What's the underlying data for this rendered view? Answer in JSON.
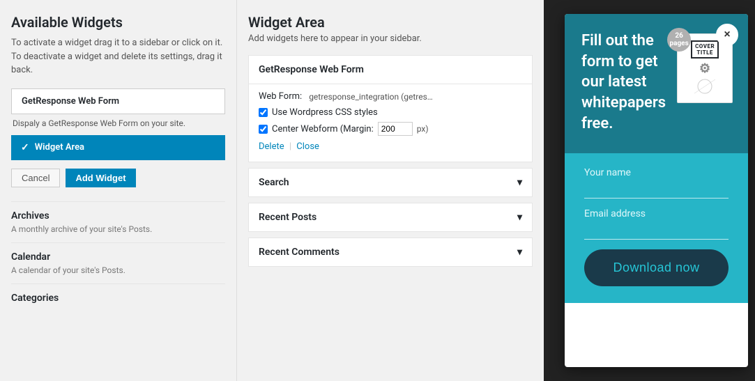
{
  "left_panel": {
    "title": "Available Widgets",
    "description": "To activate a widget drag it to a sidebar or click on it. To deactivate a widget and delete its settings, drag it back.",
    "widgets": [
      {
        "name": "GetResponse Web Form",
        "description": "Dispaly a GetResponse Web Form on your site."
      }
    ],
    "active_widget": "Widget Area",
    "cancel_label": "Cancel",
    "add_widget_label": "Add Widget",
    "list_items": [
      {
        "name": "Archives",
        "desc": "A monthly archive of your site's Posts."
      },
      {
        "name": "Calendar",
        "desc": "A calendar of your site's Posts."
      },
      {
        "name": "Categories",
        "desc": ""
      }
    ]
  },
  "center_panel": {
    "title": "Widget Area",
    "description": "Add widgets here to appear in your sidebar.",
    "getresponse_card": {
      "header": "GetResponse Web Form",
      "web_form_label": "Web Form:",
      "web_form_value": "getresponse_integration (getresponse_int...",
      "checkbox1_label": "Use Wordpress CSS styles",
      "checkbox2_label": "Center Webform (Margin:",
      "margin_value": "200",
      "px_label": "px)",
      "delete_label": "Delete",
      "close_label": "Close"
    },
    "collapsed_widgets": [
      {
        "label": "Search"
      },
      {
        "label": "Recent Posts"
      },
      {
        "label": "Recent Comments"
      }
    ]
  },
  "popup": {
    "close_icon": "×",
    "headline": "Fill out the form to get our latest whitepapers free.",
    "cover": {
      "title": "COVER\nTITLE",
      "pages": "26",
      "pages_label": "pages"
    },
    "your_name_label": "Your name",
    "email_label": "Email address",
    "download_btn_label": "Download now"
  }
}
